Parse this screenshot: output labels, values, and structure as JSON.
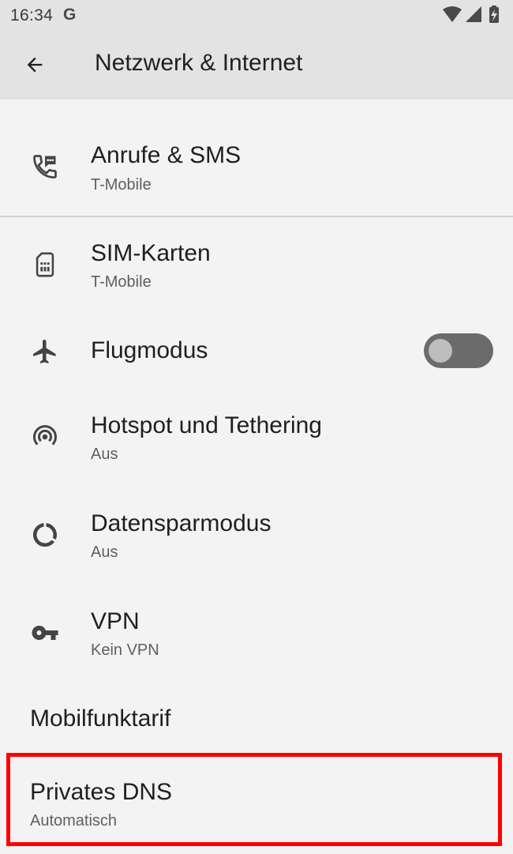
{
  "status_bar": {
    "time": "16:34",
    "g_badge": "G",
    "icons": [
      "wifi-icon",
      "cell-signal-icon",
      "battery-charging-icon"
    ]
  },
  "app_bar": {
    "title": "Netzwerk & Internet",
    "back_icon": "back-arrow-icon"
  },
  "items": [
    {
      "id": "calls-sms",
      "title": "Anrufe & SMS",
      "subtitle": "T-Mobile",
      "icon": "phone-sms-icon"
    },
    {
      "id": "sim-cards",
      "title": "SIM-Karten",
      "subtitle": "T-Mobile",
      "icon": "sim-card-icon"
    },
    {
      "id": "airplane-mode",
      "title": "Flugmodus",
      "icon": "airplane-icon",
      "toggle_on": false
    },
    {
      "id": "hotspot",
      "title": "Hotspot und Tethering",
      "subtitle": "Aus",
      "icon": "hotspot-icon"
    },
    {
      "id": "data-saver",
      "title": "Datensparmodus",
      "subtitle": "Aus",
      "icon": "data-saver-icon"
    },
    {
      "id": "vpn",
      "title": "VPN",
      "subtitle": "Kein VPN",
      "icon": "vpn-key-icon"
    }
  ],
  "mobile_plan": {
    "title": "Mobilfunktarif"
  },
  "private_dns": {
    "title": "Privates DNS",
    "subtitle": "Automatisch",
    "highlight_color": "#ff0000"
  },
  "colors": {
    "background": "#f3f3f3",
    "app_bar": "#e3e3e3",
    "icon": "#444444",
    "toggle_track": "#6b6b6b",
    "toggle_knob": "#bdbdbd"
  }
}
